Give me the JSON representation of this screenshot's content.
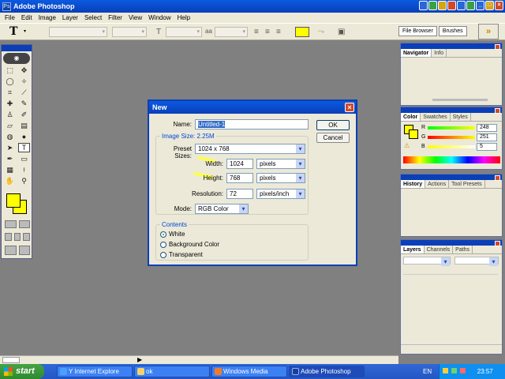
{
  "window": {
    "title": "Adobe Photoshop"
  },
  "menu": [
    "File",
    "Edit",
    "Image",
    "Layer",
    "Select",
    "Filter",
    "View",
    "Window",
    "Help"
  ],
  "options_bar": {
    "palette_tabs": [
      "File Browser",
      "Brushes"
    ]
  },
  "colors": {
    "foreground": "#ffff00",
    "background": "#ffff00",
    "accent": "#0a3fb8"
  },
  "toolbox": {
    "tools": [
      "marquee-icon",
      "move-icon",
      "lasso-icon",
      "magic-wand-icon",
      "crop-icon",
      "slice-icon",
      "healing-icon",
      "brush-icon",
      "stamp-icon",
      "history-brush-icon",
      "eraser-icon",
      "gradient-icon",
      "blur-icon",
      "dodge-icon",
      "path-select-icon",
      "type-icon",
      "pen-icon",
      "shape-icon",
      "notes-icon",
      "eyedropper-icon",
      "hand-icon",
      "zoom-icon"
    ],
    "active": "type-icon"
  },
  "panels": {
    "navigator": {
      "tabs": [
        "Navigator",
        "Info"
      ]
    },
    "color": {
      "tabs": [
        "Color",
        "Swatches",
        "Styles"
      ],
      "r": "248",
      "g": "251",
      "b": "5",
      "r_label": "R",
      "g_label": "G",
      "b_label": "B"
    },
    "history": {
      "tabs": [
        "History",
        "Actions",
        "Tool Presets"
      ]
    },
    "layers": {
      "tabs": [
        "Layers",
        "Channels",
        "Paths"
      ]
    }
  },
  "dialog": {
    "title": "New",
    "name_label": "Name:",
    "name_value": "Untitled-1",
    "image_size": "Image Size: 2.25M",
    "preset_label": "Preset Sizes:",
    "preset_value": "1024 x 768",
    "width_label": "Width:",
    "width_value": "1024",
    "width_unit": "pixels",
    "height_label": "Height:",
    "height_value": "768",
    "height_unit": "pixels",
    "resolution_label": "Resolution:",
    "resolution_value": "72",
    "resolution_unit": "pixels/inch",
    "mode_label": "Mode:",
    "mode_value": "RGB Color",
    "ok": "OK",
    "cancel": "Cancel",
    "contents_label": "Contents",
    "contents_options": [
      "White",
      "Background Color",
      "Transparent"
    ],
    "contents_selected": "White"
  },
  "taskbar": {
    "start": "start",
    "tasks": [
      "Y Internet Explore",
      "ok",
      "Windows Media Player",
      "Adobe Photoshop"
    ],
    "active_task": "Adobe Photoshop",
    "lang": "EN",
    "clock": "23:57"
  }
}
